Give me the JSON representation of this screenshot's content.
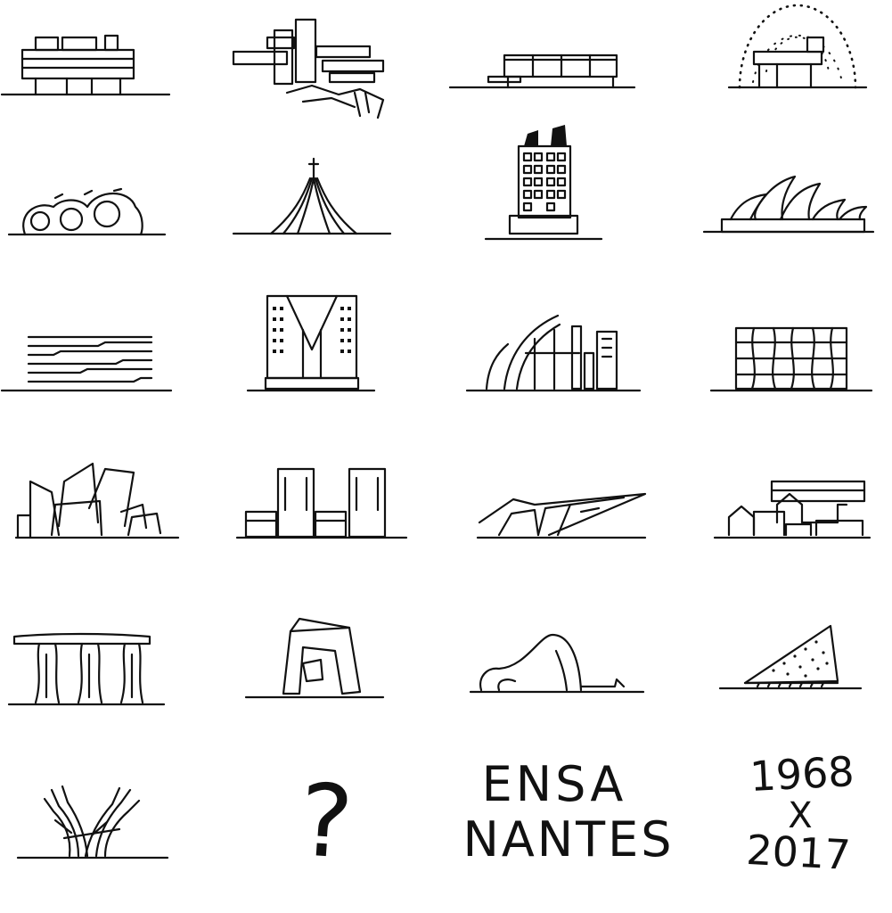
{
  "sketches": [
    {
      "row": 1,
      "col": 1,
      "icon": "villa-savoye-sketch-icon"
    },
    {
      "row": 1,
      "col": 2,
      "icon": "fallingwater-sketch-icon"
    },
    {
      "row": 1,
      "col": 3,
      "icon": "farnsworth-house-sketch-icon"
    },
    {
      "row": 1,
      "col": 4,
      "icon": "geodesic-dome-sketch-icon"
    },
    {
      "row": 2,
      "col": 1,
      "icon": "bubble-house-sketch-icon"
    },
    {
      "row": 2,
      "col": 2,
      "icon": "brasilia-cathedral-sketch-icon"
    },
    {
      "row": 2,
      "col": 3,
      "icon": "capsule-tower-sketch-icon"
    },
    {
      "row": 2,
      "col": 4,
      "icon": "sydney-opera-house-sketch-icon"
    },
    {
      "row": 3,
      "col": 1,
      "icon": "striped-facade-sketch-icon"
    },
    {
      "row": 3,
      "col": 2,
      "icon": "monumental-tower-sketch-icon"
    },
    {
      "row": 3,
      "col": 3,
      "icon": "sail-church-sketch-icon"
    },
    {
      "row": 3,
      "col": 4,
      "icon": "lattice-block-sketch-icon"
    },
    {
      "row": 4,
      "col": 1,
      "icon": "concert-hall-sketch-icon"
    },
    {
      "row": 4,
      "col": 2,
      "icon": "twin-towers-sketch-icon"
    },
    {
      "row": 4,
      "col": 3,
      "icon": "angular-museum-sketch-icon"
    },
    {
      "row": 4,
      "col": 4,
      "icon": "stacked-houses-sketch-icon"
    },
    {
      "row": 5,
      "col": 1,
      "icon": "marina-bay-sands-sketch-icon"
    },
    {
      "row": 5,
      "col": 2,
      "icon": "cctv-loop-tower-sketch-icon"
    },
    {
      "row": 5,
      "col": 3,
      "icon": "wave-center-sketch-icon"
    },
    {
      "row": 5,
      "col": 4,
      "icon": "triangular-building-sketch-icon"
    },
    {
      "row": 6,
      "col": 1,
      "icon": "branching-columns-sketch-icon"
    }
  ],
  "question_mark": "?",
  "school": {
    "line1": "ENSA",
    "line2": "NANTES"
  },
  "years": {
    "start": "1968",
    "separator": "X",
    "end": "2017"
  }
}
